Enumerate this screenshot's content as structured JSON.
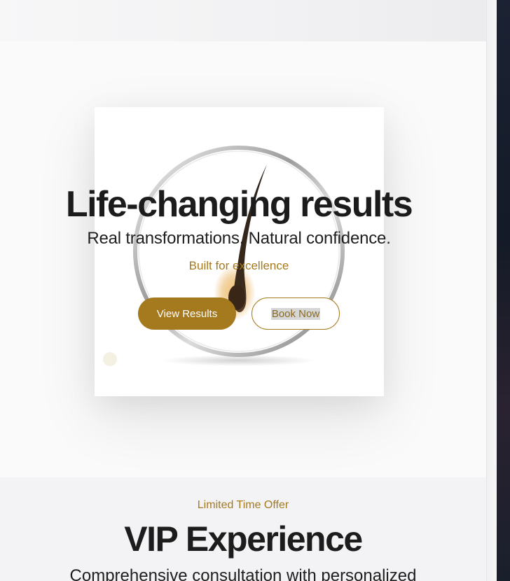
{
  "hero": {
    "title": "Life-changing results",
    "subtitle": "Real transformations. Natural confidence.",
    "tagline": "Built for excellence",
    "primary_button": "View Results",
    "secondary_button": "Book Now"
  },
  "offer": {
    "eyebrow": "Limited Time Offer",
    "title": "VIP Experience",
    "text": "Comprehensive consultation with personalized"
  },
  "colors": {
    "accent": "#a57a1f",
    "text": "#1c1c1c",
    "offer_background": "#f3f3f5"
  },
  "icons": {
    "hero_image": "hair-follicle-magnifier-image"
  }
}
